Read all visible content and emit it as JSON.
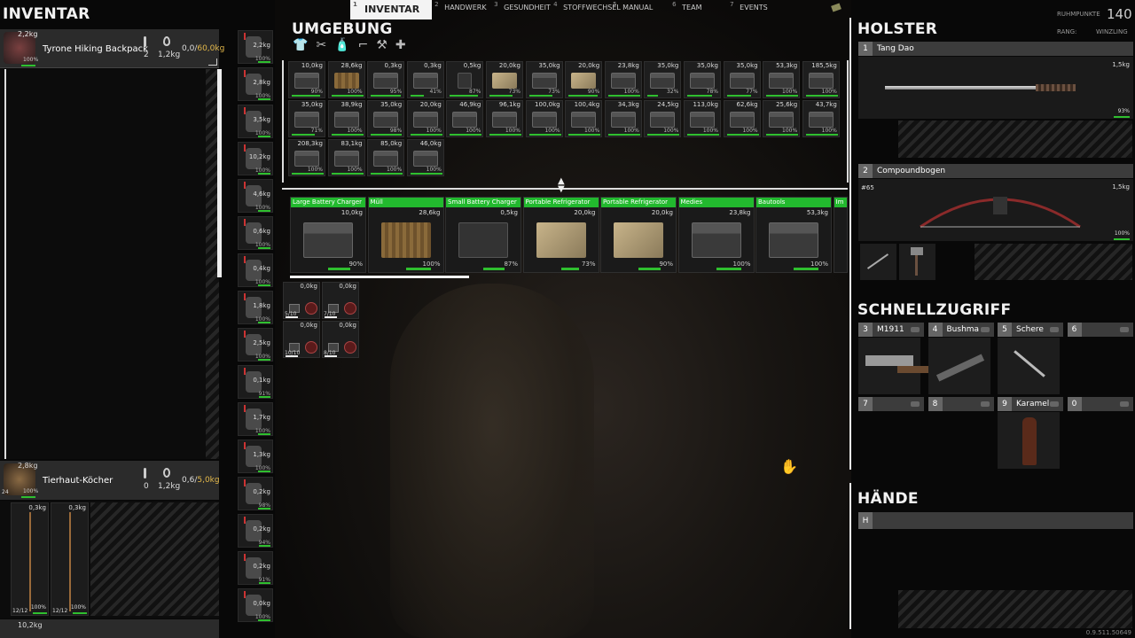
{
  "tabs": [
    {
      "num": "1",
      "label": "INVENTAR",
      "active": true
    },
    {
      "num": "2",
      "label": "HANDWERK"
    },
    {
      "num": "3",
      "label": "GESUNDHEIT"
    },
    {
      "num": "4",
      "label": "STOFFWECHSEL"
    },
    {
      "num": "5",
      "label": "MANUAL"
    },
    {
      "num": "6",
      "label": "TEAM"
    },
    {
      "num": "7",
      "label": "EVENTS"
    }
  ],
  "rank": {
    "points_label": "RUHMPUNKTE",
    "points": "140",
    "rank_label": "RANG:",
    "rank": "WINZLING"
  },
  "inventory": {
    "title": "INVENTAR",
    "backpack": {
      "name": "Tyrone Hiking Backpack",
      "weight": "2,2kg",
      "cond": "100%",
      "temp": "2",
      "water": "1,2kg",
      "load": "0,0/",
      "cap": "60,0kg"
    },
    "quiver": {
      "name": "Tierhaut-Köcher",
      "weight": "2,8kg",
      "cond": "100%",
      "count": "24",
      "temp": "0",
      "water": "1,2kg",
      "load": "0,6/",
      "cap": "5,0kg",
      "arrows": [
        {
          "w": "0,3kg",
          "c": "100%",
          "n": "12/12"
        },
        {
          "w": "0,3kg",
          "c": "100%",
          "n": "12/12"
        }
      ]
    },
    "bottom": {
      "weight": "10,2kg"
    }
  },
  "equip_side": [
    {
      "w": "2,2kg",
      "c": "100%"
    },
    {
      "w": "2,8kg",
      "c": "100%"
    },
    {
      "w": "3,5kg",
      "c": "100%"
    },
    {
      "w": "10,2kg",
      "c": "100%"
    },
    {
      "w": "4,6kg",
      "c": "100%"
    },
    {
      "w": "0,6kg",
      "c": "100%"
    },
    {
      "w": "0,4kg",
      "c": "100%"
    },
    {
      "w": "1,8kg",
      "c": "100%"
    },
    {
      "w": "2,5kg",
      "c": "100%"
    },
    {
      "w": "0,1kg",
      "c": "91%"
    },
    {
      "w": "1,7kg",
      "c": "100%"
    },
    {
      "w": "1,3kg",
      "c": "100%"
    },
    {
      "w": "0,2kg",
      "c": "98%"
    },
    {
      "w": "0,2kg",
      "c": "94%"
    },
    {
      "w": "0,2kg",
      "c": "91%"
    },
    {
      "w": "0,0kg",
      "c": "100%"
    }
  ],
  "environment": {
    "title": "UMGEBUNG",
    "grid": [
      {
        "w": "10,0kg",
        "c": "90%",
        "t": "metal"
      },
      {
        "w": "28,6kg",
        "c": "100%",
        "t": "wood"
      },
      {
        "w": "0,3kg",
        "c": "95%",
        "t": "metal"
      },
      {
        "w": "0,3kg",
        "c": "41%",
        "t": "metal"
      },
      {
        "w": "0,5kg",
        "c": "87%",
        "t": "dev"
      },
      {
        "w": "20,0kg",
        "c": "73%",
        "t": "box"
      },
      {
        "w": "35,0kg",
        "c": "73%",
        "t": "metal"
      },
      {
        "w": "20,0kg",
        "c": "90%",
        "t": "box"
      },
      {
        "w": "23,8kg",
        "c": "100%",
        "t": "metal"
      },
      {
        "w": "35,0kg",
        "c": "32%",
        "t": "metal"
      },
      {
        "w": "35,0kg",
        "c": "78%",
        "t": "metal"
      },
      {
        "w": "35,0kg",
        "c": "77%",
        "t": "metal"
      },
      {
        "w": "53,3kg",
        "c": "100%",
        "t": "metal"
      },
      {
        "w": "185,5kg",
        "c": "100%",
        "t": "metal"
      },
      {
        "w": "35,0kg",
        "c": "71%",
        "t": "metal"
      },
      {
        "w": "38,9kg",
        "c": "100%",
        "t": "metal"
      },
      {
        "w": "35,0kg",
        "c": "98%",
        "t": "metal"
      },
      {
        "w": "20,0kg",
        "c": "100%",
        "t": "metal"
      },
      {
        "w": "46,9kg",
        "c": "100%",
        "t": "metal"
      },
      {
        "w": "96,1kg",
        "c": "100%",
        "t": "metal"
      },
      {
        "w": "100,0kg",
        "c": "100%",
        "t": "metal"
      },
      {
        "w": "100,4kg",
        "c": "100%",
        "t": "metal"
      },
      {
        "w": "34,3kg",
        "c": "100%",
        "t": "metal"
      },
      {
        "w": "24,5kg",
        "c": "100%",
        "t": "metal"
      },
      {
        "w": "113,0kg",
        "c": "100%",
        "t": "metal"
      },
      {
        "w": "62,6kg",
        "c": "100%",
        "t": "metal"
      },
      {
        "w": "25,6kg",
        "c": "100%",
        "t": "metal"
      },
      {
        "w": "43,7kg",
        "c": "100%",
        "t": "metal"
      },
      {
        "w": "208,3kg",
        "c": "100%",
        "t": "metal"
      },
      {
        "w": "83,1kg",
        "c": "100%",
        "t": "metal"
      },
      {
        "w": "85,0kg",
        "c": "100%",
        "t": "metal"
      },
      {
        "w": "46,0kg",
        "c": "100%",
        "t": "metal"
      }
    ],
    "containers": [
      {
        "name": "Large Battery Charger",
        "w": "10,0kg",
        "c": "90%",
        "t": "metal"
      },
      {
        "name": "Müll",
        "w": "28,6kg",
        "c": "100%",
        "t": "wood"
      },
      {
        "name": "Small Battery Charger",
        "w": "0,5kg",
        "c": "87%",
        "t": "dev"
      },
      {
        "name": "Portable Refrigerator",
        "w": "20,0kg",
        "c": "73%",
        "t": "box"
      },
      {
        "name": "Portable Refrigerator",
        "w": "20,0kg",
        "c": "90%",
        "t": "box"
      },
      {
        "name": "Medies",
        "w": "23,8kg",
        "c": "100%",
        "t": "metal"
      },
      {
        "name": "Bautools",
        "w": "53,3kg",
        "c": "100%",
        "t": "metal"
      },
      {
        "name": "Im",
        "w": "",
        "c": "",
        "t": "metal"
      }
    ],
    "small": [
      {
        "w": "0,0kg",
        "n": "5/10"
      },
      {
        "w": "0,0kg",
        "n": "7/10"
      },
      {
        "w": "0,0kg",
        "n": "10/10"
      },
      {
        "w": "0,0kg",
        "n": "8/10"
      }
    ]
  },
  "holster": {
    "title": "HOLSTER",
    "slots": [
      {
        "num": "1",
        "name": "Tang Dao",
        "w": "1,5kg",
        "c": "93%"
      },
      {
        "num": "2",
        "name": "Compoundbogen",
        "w": "1,5kg",
        "c": "100%",
        "ammo": "#65"
      }
    ]
  },
  "quick": {
    "title": "SCHNELLZUGRIFF",
    "slots": [
      {
        "num": "3",
        "name": "M1911"
      },
      {
        "num": "4",
        "name": "Bushma"
      },
      {
        "num": "5",
        "name": "Schere"
      },
      {
        "num": "6",
        "name": ""
      },
      {
        "num": "7",
        "name": ""
      },
      {
        "num": "8",
        "name": ""
      },
      {
        "num": "9",
        "name": "Karamel"
      },
      {
        "num": "0",
        "name": ""
      }
    ]
  },
  "hands": {
    "title": "HÄNDE",
    "slot": "H"
  },
  "version": "0.9.511.50649"
}
